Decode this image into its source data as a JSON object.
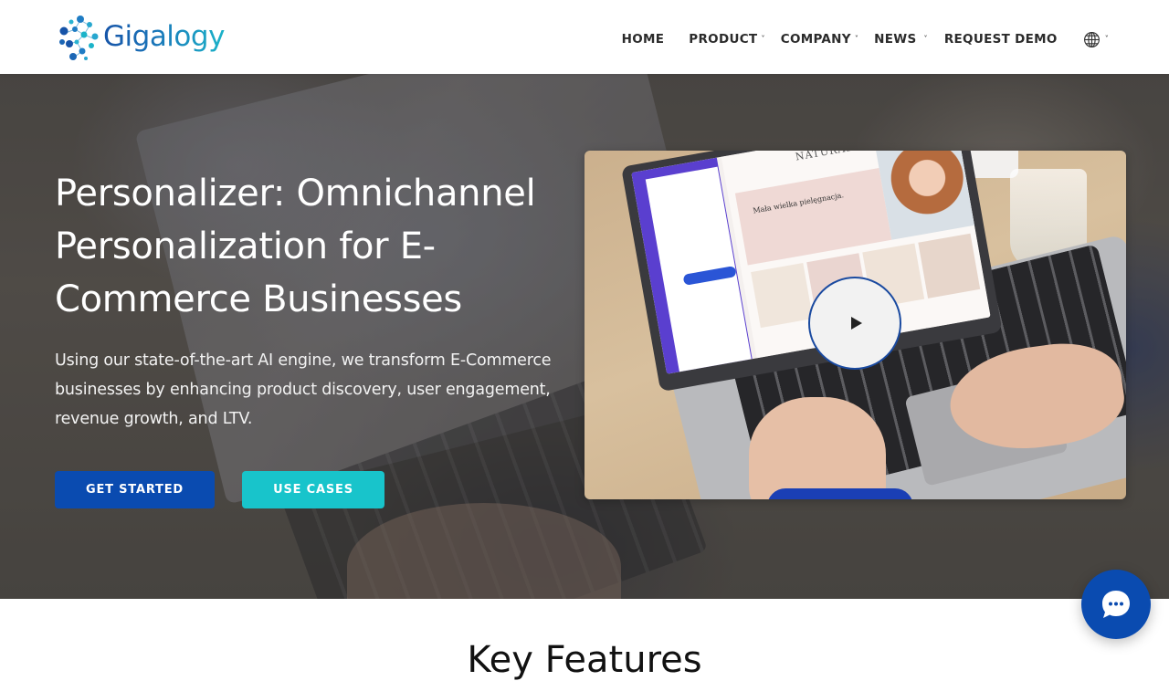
{
  "brand": {
    "name": "Gigalogy",
    "colors": {
      "primary": "#0a4bb0",
      "accent": "#18c4cb",
      "logo_dark": "#1654a8",
      "logo_light": "#1bb3c9"
    }
  },
  "nav": {
    "items": [
      {
        "label": "HOME",
        "dropdown": false
      },
      {
        "label": "PRODUCT",
        "dropdown": true
      },
      {
        "label": "COMPANY",
        "dropdown": true
      },
      {
        "label": "NEWS",
        "dropdown": true
      },
      {
        "label": "REQUEST DEMO",
        "dropdown": false
      }
    ],
    "language_icon": "globe-icon",
    "caret": "˅"
  },
  "hero": {
    "title": "Personalizer: Omnichannel Personalization for E-Commerce Businesses",
    "description": "Using our state-of-the-art AI engine, we transform E-Commerce businesses by enhancing product discovery, user engagement, revenue growth, and LTV.",
    "buttons": {
      "get_started": "GET STARTED",
      "use_cases": "USE CASES"
    },
    "video": {
      "play_icon": "play-icon",
      "site_title": "NATURAL be",
      "banner_text": "Mała wielka pielęgnacja."
    }
  },
  "features": {
    "title": "Key Features"
  },
  "chat": {
    "icon": "chat-bubble-icon"
  }
}
